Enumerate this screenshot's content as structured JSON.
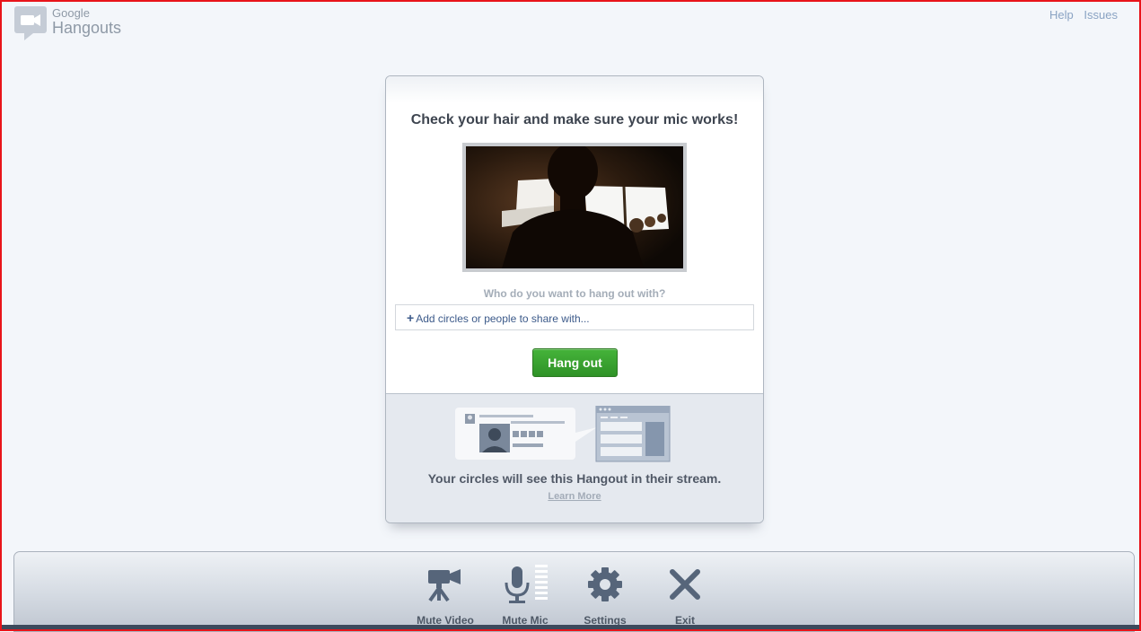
{
  "header": {
    "logo_top": "Google",
    "logo_bottom": "Hangouts",
    "logo_icon": "hangouts-camera-bubble-icon",
    "links": [
      "Help",
      "Issues"
    ]
  },
  "card": {
    "title": "Check your hair and make sure your mic works!",
    "who_label": "Who do you want to hang out with?",
    "share_placeholder": "Add circles or people to share with...",
    "share_plus": "+",
    "hangout_button": "Hang out",
    "stream_text": "Your circles will see this Hangout in their stream.",
    "learn_more": "Learn More"
  },
  "toolbar": {
    "items": [
      {
        "label": "Mute Video",
        "icon": "video-camera-icon"
      },
      {
        "label": "Mute Mic",
        "icon": "microphone-icon"
      },
      {
        "label": "Settings",
        "icon": "gear-icon"
      },
      {
        "label": "Exit",
        "icon": "close-icon"
      }
    ]
  },
  "colors": {
    "hangout_green": "#3aa52f",
    "link_blue": "#8aa3c3",
    "border_red": "#e8141a"
  }
}
